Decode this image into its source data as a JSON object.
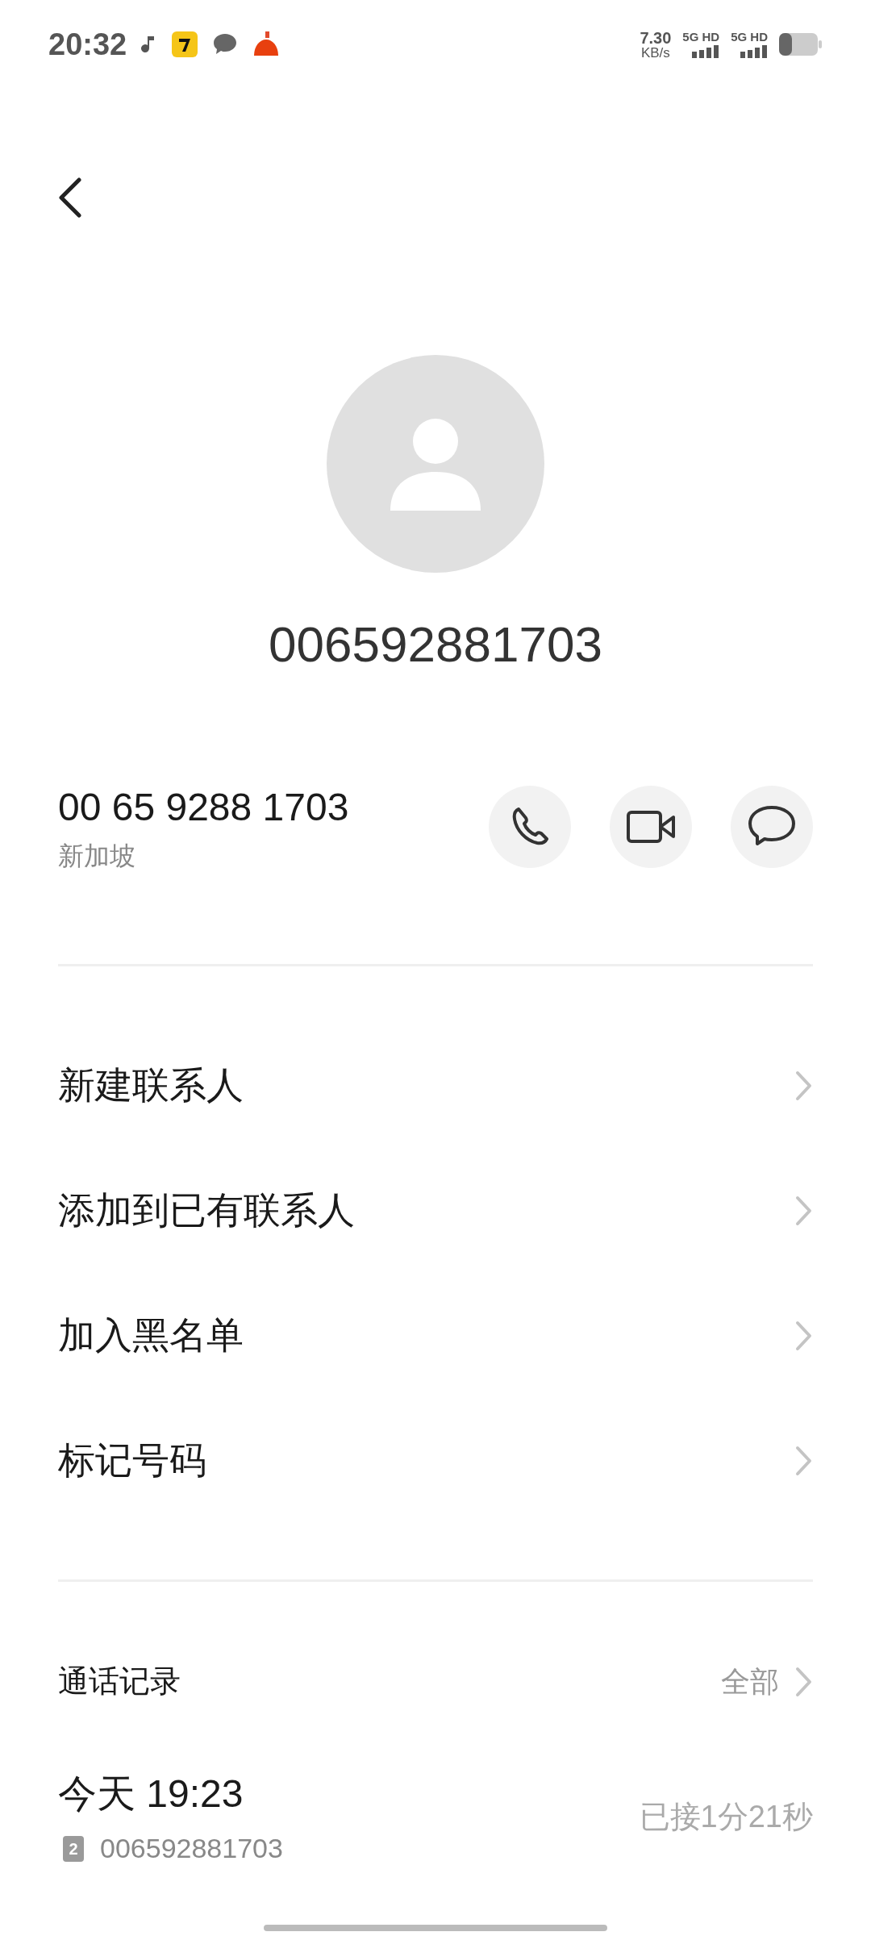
{
  "status_bar": {
    "time": "20:32",
    "speed": "7.30",
    "speed_unit": "KB/s",
    "networks": [
      "5G HD",
      "5G HD"
    ]
  },
  "contact": {
    "title": "006592881703"
  },
  "number": {
    "value": "00 65 9288 1703",
    "location": "新加坡"
  },
  "actions": [
    {
      "kind": "call"
    },
    {
      "kind": "video"
    },
    {
      "kind": "message"
    }
  ],
  "menu": [
    "新建联系人",
    "添加到已有联系人",
    "加入黑名单",
    "标记号码"
  ],
  "call_log": {
    "title": "通话记录",
    "filter": "全部",
    "entries": [
      {
        "time": "今天 19:23",
        "sim": "2",
        "number": "006592881703",
        "status": "已接1分21秒"
      }
    ]
  }
}
